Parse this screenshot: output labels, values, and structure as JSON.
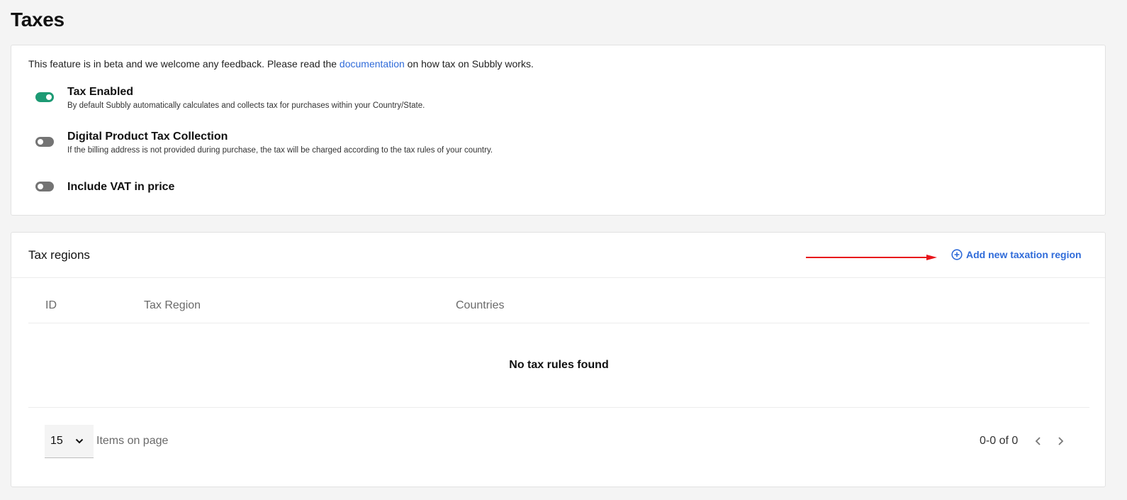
{
  "page": {
    "title": "Taxes"
  },
  "settings": {
    "beta_prefix": "This feature is in beta and we welcome any feedback. Please read the ",
    "beta_link": "documentation",
    "beta_suffix": " on how tax on Subbly works.",
    "toggles": [
      {
        "title": "Tax Enabled",
        "description": "By default Subbly automatically calculates and collects tax for purchases within your Country/State.",
        "enabled": true
      },
      {
        "title": "Digital Product Tax Collection",
        "description": "If the billing address is not provided during purchase, the tax will be charged according to the tax rules of your country.",
        "enabled": false
      },
      {
        "title": "Include VAT in price",
        "description": "",
        "enabled": false
      }
    ]
  },
  "regions": {
    "title": "Tax regions",
    "add_label": "Add new taxation region",
    "columns": [
      "ID",
      "Tax Region",
      "Countries"
    ],
    "empty_message": "No tax rules found",
    "pager": {
      "page_size": "15",
      "items_label": "Items on page",
      "range": "0-0 of 0"
    }
  },
  "colors": {
    "accent": "#2f6bd9",
    "toggle_on": "#1d9a74",
    "toggle_off": "#747474",
    "annotation_arrow": "#e8141b"
  }
}
